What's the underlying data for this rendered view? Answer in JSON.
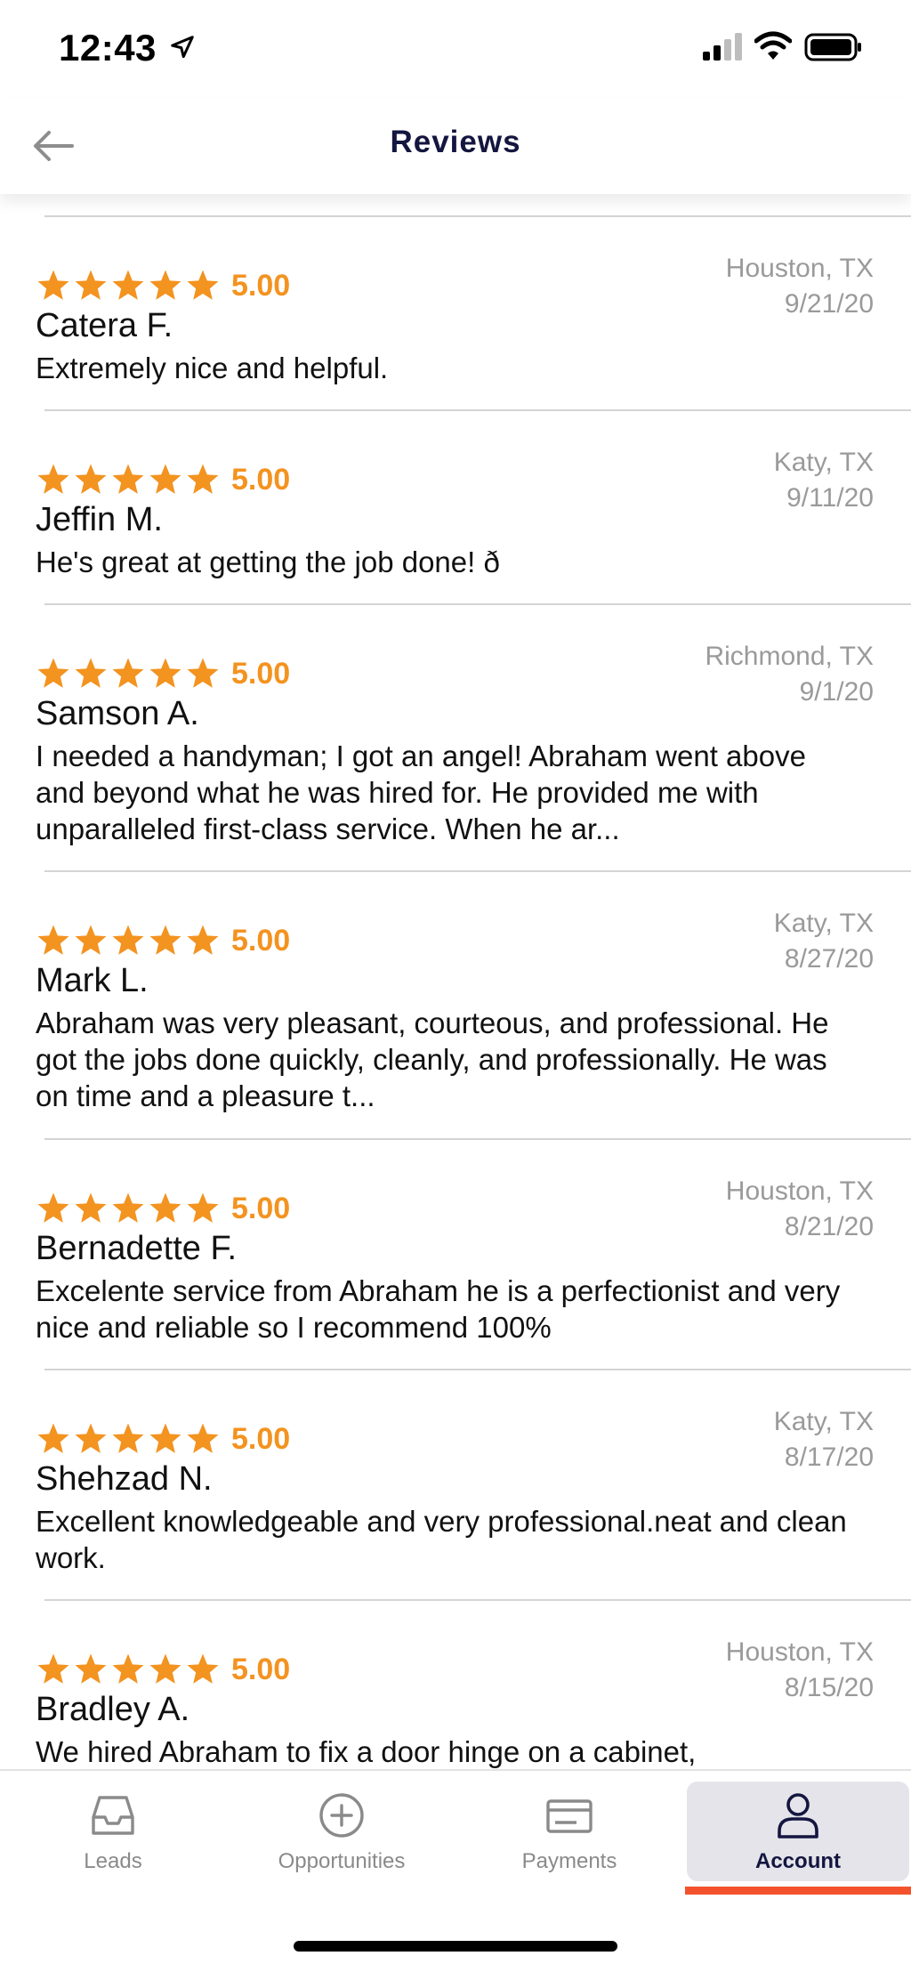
{
  "status_bar": {
    "time": "12:43"
  },
  "header": {
    "title": "Reviews"
  },
  "accent_color": "#f39320",
  "reviews": [
    {
      "rating": "5.00",
      "location": "Houston, TX",
      "date": "9/21/20",
      "name": "Catera F.",
      "text": "Extremely nice and helpful."
    },
    {
      "rating": "5.00",
      "location": "Katy, TX",
      "date": "9/11/20",
      "name": "Jeffin M.",
      "text": "He's great at getting the job done! ð"
    },
    {
      "rating": "5.00",
      "location": "Richmond, TX",
      "date": "9/1/20",
      "name": "Samson A.",
      "text": "I needed a handyman; I got an angel! Abraham went above and beyond what he was hired for. He provided me with unparalleled first-class service. When he ar..."
    },
    {
      "rating": "5.00",
      "location": "Katy, TX",
      "date": "8/27/20",
      "name": "Mark L.",
      "text": "Abraham was very pleasant, courteous, and professional. He got the jobs done quickly, cleanly, and professionally. He was on time and a pleasure t..."
    },
    {
      "rating": "5.00",
      "location": "Houston, TX",
      "date": "8/21/20",
      "name": "Bernadette F.",
      "text": "Excelente service from Abraham he is a perfectionist and very nice and reliable so I recommend 100%"
    },
    {
      "rating": "5.00",
      "location": "Katy, TX",
      "date": "8/17/20",
      "name": "Shehzad N.",
      "text": "Excellent knowledgeable and very professional.neat and clean work."
    },
    {
      "rating": "5.00",
      "location": "Houston, TX",
      "date": "8/15/20",
      "name": "Bradley A.",
      "text": "We hired Abraham to fix a door hinge on a cabinet,"
    }
  ],
  "tabs": [
    {
      "label": "Leads",
      "icon": "inbox-icon"
    },
    {
      "label": "Opportunities",
      "icon": "plus-circle-icon"
    },
    {
      "label": "Payments",
      "icon": "card-icon"
    },
    {
      "label": "Account",
      "icon": "person-icon",
      "active": true
    }
  ]
}
